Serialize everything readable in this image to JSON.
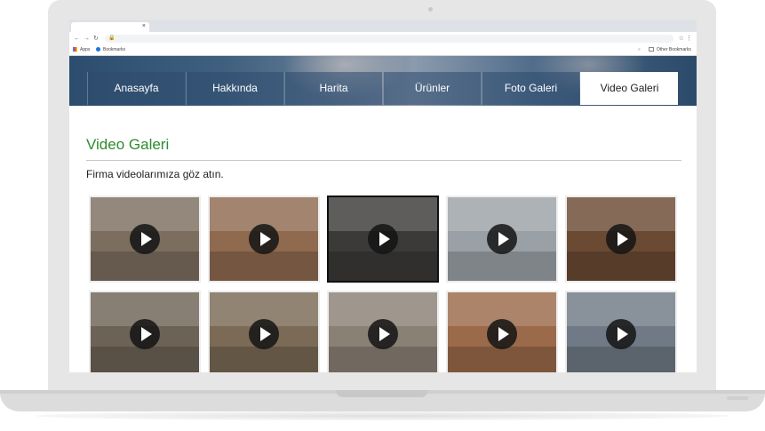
{
  "browser": {
    "tab_close": "×",
    "bookmarks": [
      {
        "label": "Apps"
      },
      {
        "label": "Bookmarks"
      },
      {
        "label": "Other Bookmarks"
      }
    ]
  },
  "nav": {
    "items": [
      {
        "label": "Anasayfa"
      },
      {
        "label": "Hakkında"
      },
      {
        "label": "Harita"
      },
      {
        "label": "Ürünler"
      },
      {
        "label": "Foto Galeri"
      },
      {
        "label": "Video Galeri"
      }
    ],
    "active_index": 5
  },
  "main": {
    "title": "Video Galeri",
    "lead": "Firma videolarımıza göz atın."
  },
  "gallery": {
    "colors": [
      "#7c6e5f",
      "#8f6a4f",
      "#3b3a38",
      "#9aa1a6",
      "#6b4a34",
      "#6d6256",
      "#7b6a55",
      "#8a8175",
      "#9a6a4a",
      "#6f7a86"
    ]
  },
  "colors": {
    "title_green": "#2e8b2e",
    "nav_bg": "#2d4b6e"
  }
}
